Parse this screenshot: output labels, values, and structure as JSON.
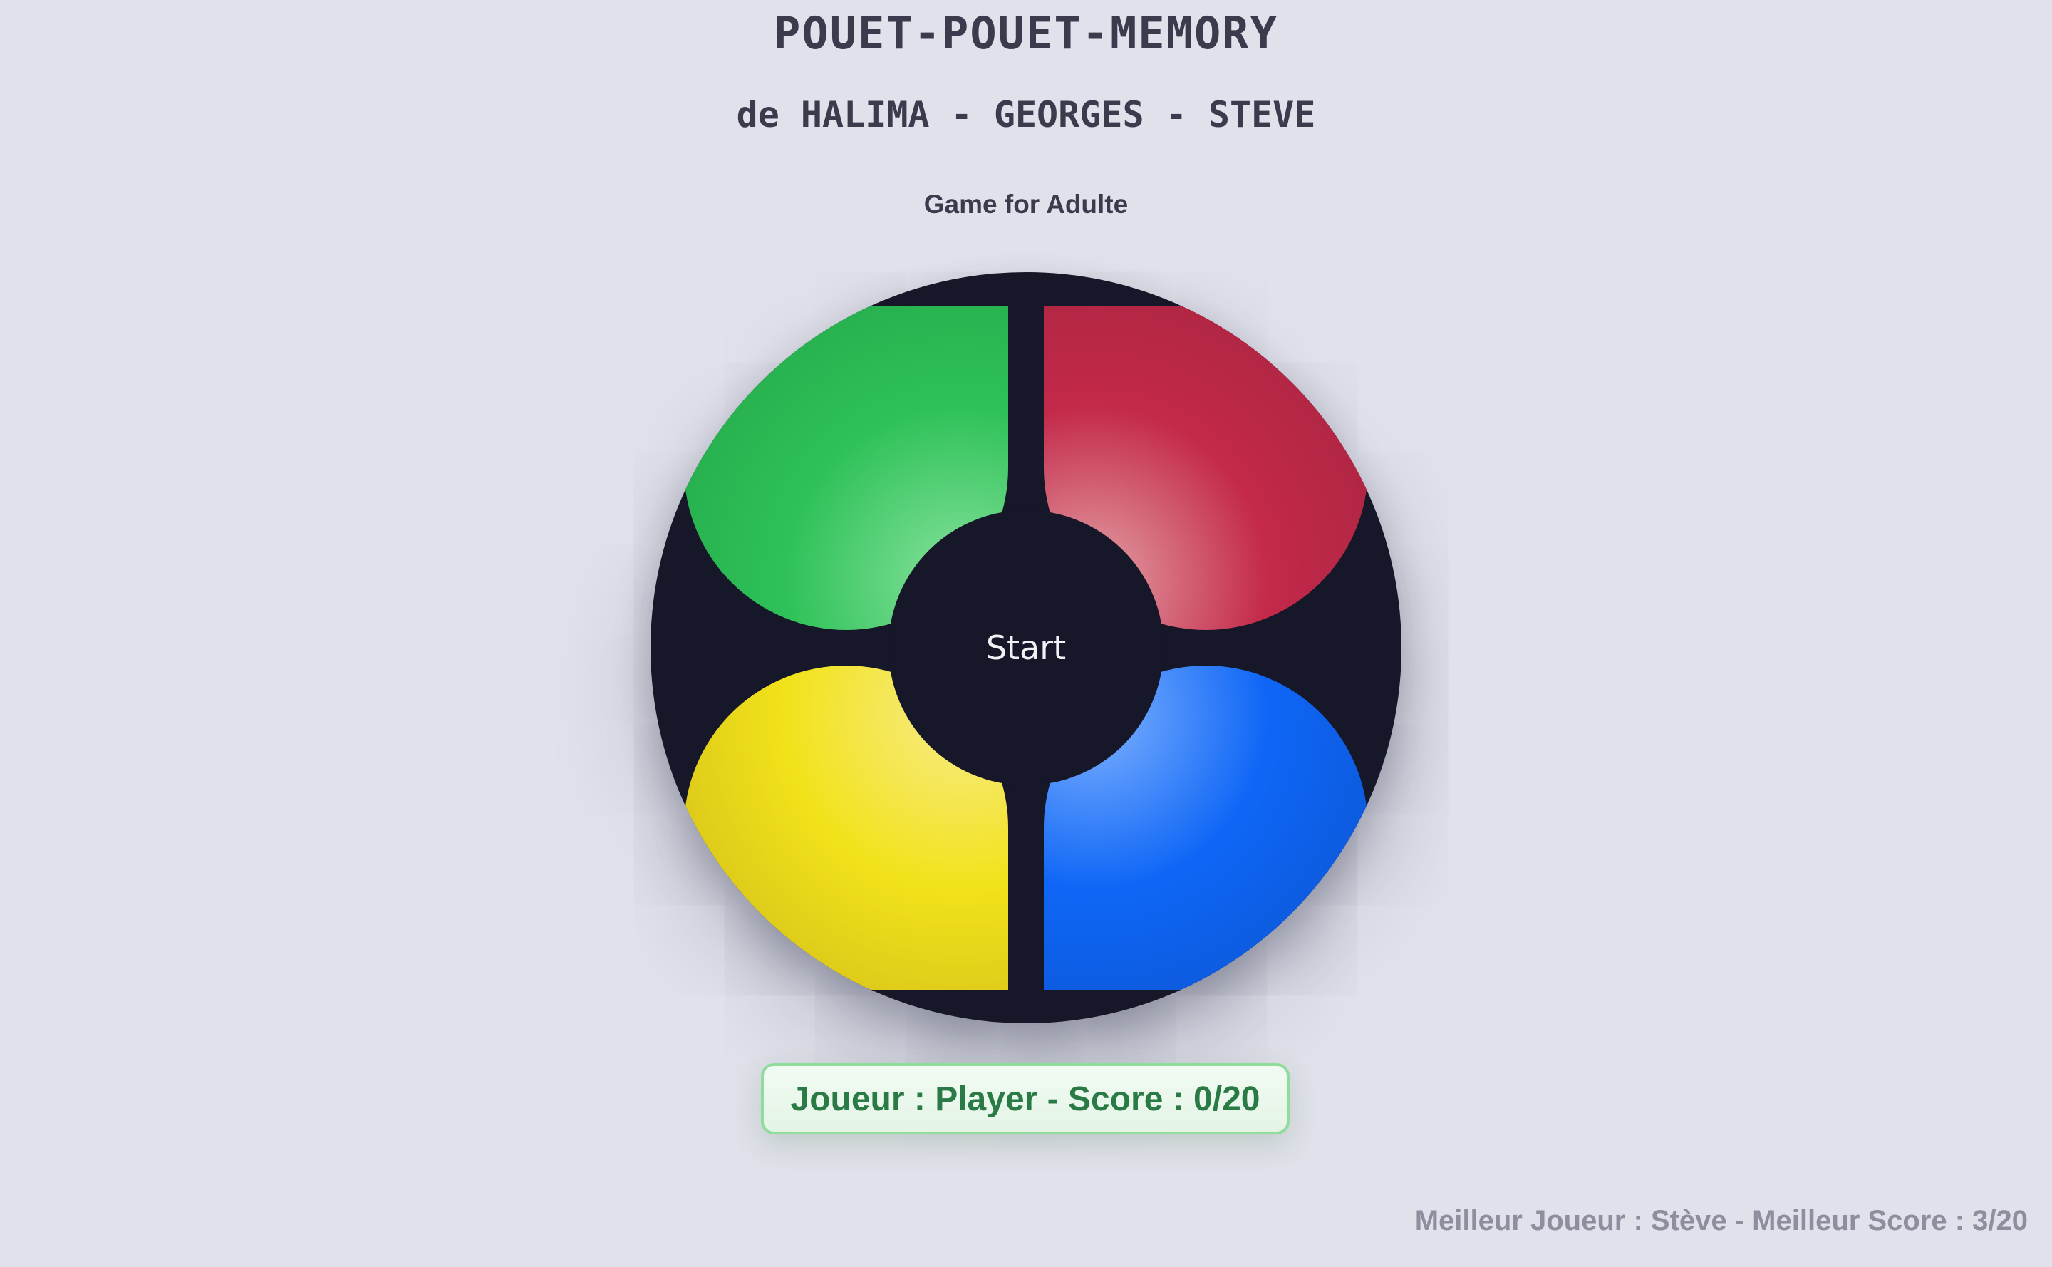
{
  "header": {
    "title": "POUET-POUET-MEMORY",
    "authors": "de HALIMA - GEORGES - STEVE",
    "subtitle": "Game for Adulte"
  },
  "board": {
    "pads": [
      {
        "name": "green",
        "color": "#2ec158"
      },
      {
        "name": "red",
        "color": "#c4294a"
      },
      {
        "name": "yellow",
        "color": "#f2e21a"
      },
      {
        "name": "blue",
        "color": "#0f66f6"
      }
    ],
    "start_label": "Start",
    "board_color": "#161728"
  },
  "score": {
    "text": "Joueur : Player - Score : 0/20"
  },
  "best": {
    "text": "Meilleur Joueur : Stève - Meilleur Score : 3/20"
  }
}
